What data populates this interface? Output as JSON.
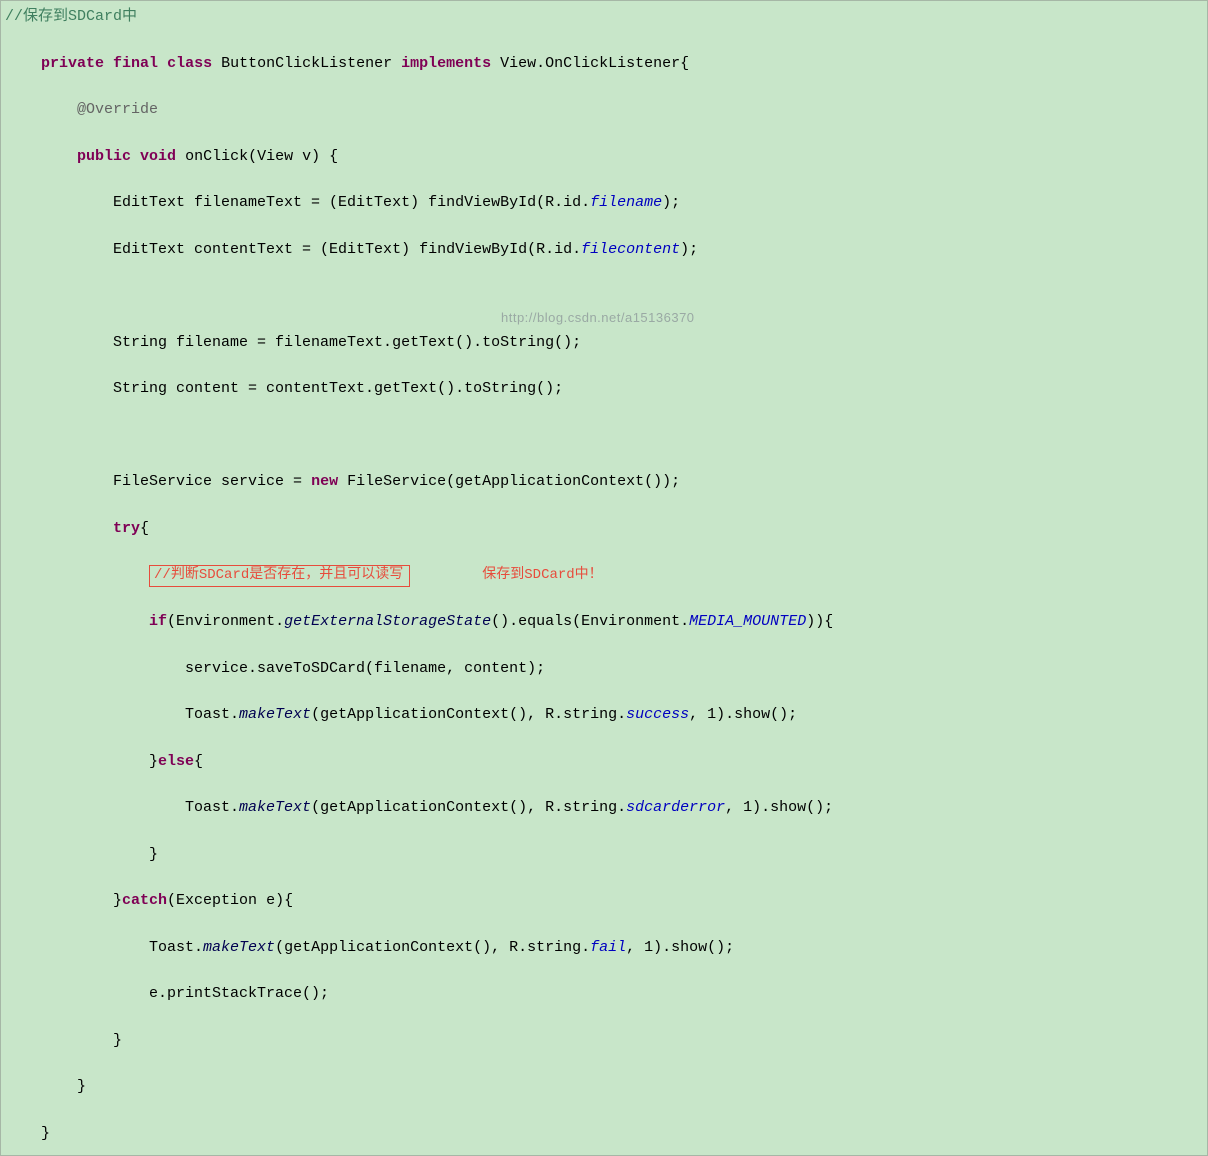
{
  "code": {
    "top_comment": "//保存到SDCard中",
    "kw_private": "private",
    "kw_final": "final",
    "kw_class": "class",
    "class_name": " ButtonClickListener ",
    "kw_implements": "implements",
    "impl_name": " View.OnClickListener{",
    "override": "@Override",
    "kw_public": "public",
    "kw_void": "void",
    "method_sig": " onClick(View v) {",
    "l1a": "            EditText filenameText = (EditText) findViewById(R.id.",
    "l1b": "filename",
    "l1c": ");",
    "l2a": "            EditText contentText = (EditText) findViewById(R.id.",
    "l2b": "filecontent",
    "l2c": ");",
    "l3": "            String filename = filenameText.getText().toString();",
    "l4": "            String content = contentText.getText().toString();",
    "l5a": "            FileService service = ",
    "kw_new": "new",
    "l5b": " FileService(getApplicationContext());",
    "kw_try": "try",
    "try_brace": "{",
    "ann_box": "//判断SDCard是否存在，并且可以读写",
    "ann_text": "保存到SDCard中！",
    "kw_if": "if",
    "if_a": "(Environment.",
    "if_b": "getExternalStorageState",
    "if_c": "().equals(Environment.",
    "if_d": "MEDIA_MOUNTED",
    "if_e": ")){",
    "svc_line": "                    service.saveToSDCard(filename, content);",
    "t1a": "                    Toast.",
    "mkText": "makeText",
    "t1b": "(getApplicationContext(), R.string.",
    "succ": "success",
    "t1c": ", 1).show();",
    "else_a": "                }",
    "kw_else": "else",
    "else_b": "{",
    "t2b": "(getApplicationContext(), R.string.",
    "sderr": "sdcarderror",
    "t2c": ", 1).show();",
    "close_if": "                }",
    "catch_a": "            }",
    "kw_catch": "catch",
    "catch_b": "(Exception e){",
    "t3a": "                Toast.",
    "t3b": "(getApplicationContext(), R.string.",
    "fail": "fail",
    "t3c": ", 1).show();",
    "stack": "                e.printStackTrace();",
    "close_catch": "            }",
    "close_method": "        }",
    "close_class": "    }"
  },
  "watermark": "http://blog.csdn.net/a15136370"
}
